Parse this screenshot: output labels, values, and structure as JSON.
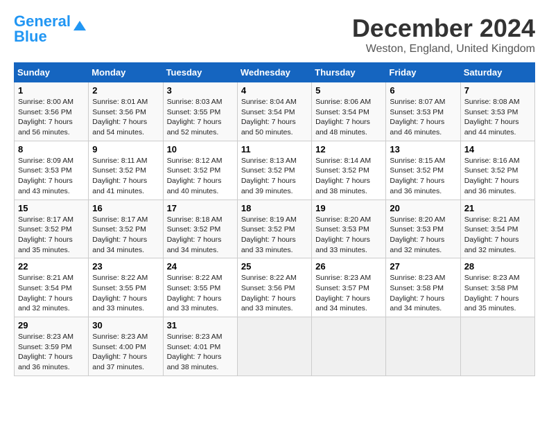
{
  "logo": {
    "text_general": "General",
    "text_blue": "Blue"
  },
  "title": {
    "month_year": "December 2024",
    "location": "Weston, England, United Kingdom"
  },
  "weekdays": [
    "Sunday",
    "Monday",
    "Tuesday",
    "Wednesday",
    "Thursday",
    "Friday",
    "Saturday"
  ],
  "weeks": [
    [
      {
        "day": "1",
        "sunrise": "8:00 AM",
        "sunset": "3:56 PM",
        "daylight": "7 hours and 56 minutes."
      },
      {
        "day": "2",
        "sunrise": "8:01 AM",
        "sunset": "3:56 PM",
        "daylight": "7 hours and 54 minutes."
      },
      {
        "day": "3",
        "sunrise": "8:03 AM",
        "sunset": "3:55 PM",
        "daylight": "7 hours and 52 minutes."
      },
      {
        "day": "4",
        "sunrise": "8:04 AM",
        "sunset": "3:54 PM",
        "daylight": "7 hours and 50 minutes."
      },
      {
        "day": "5",
        "sunrise": "8:06 AM",
        "sunset": "3:54 PM",
        "daylight": "7 hours and 48 minutes."
      },
      {
        "day": "6",
        "sunrise": "8:07 AM",
        "sunset": "3:53 PM",
        "daylight": "7 hours and 46 minutes."
      },
      {
        "day": "7",
        "sunrise": "8:08 AM",
        "sunset": "3:53 PM",
        "daylight": "7 hours and 44 minutes."
      }
    ],
    [
      {
        "day": "8",
        "sunrise": "8:09 AM",
        "sunset": "3:53 PM",
        "daylight": "7 hours and 43 minutes."
      },
      {
        "day": "9",
        "sunrise": "8:11 AM",
        "sunset": "3:52 PM",
        "daylight": "7 hours and 41 minutes."
      },
      {
        "day": "10",
        "sunrise": "8:12 AM",
        "sunset": "3:52 PM",
        "daylight": "7 hours and 40 minutes."
      },
      {
        "day": "11",
        "sunrise": "8:13 AM",
        "sunset": "3:52 PM",
        "daylight": "7 hours and 39 minutes."
      },
      {
        "day": "12",
        "sunrise": "8:14 AM",
        "sunset": "3:52 PM",
        "daylight": "7 hours and 38 minutes."
      },
      {
        "day": "13",
        "sunrise": "8:15 AM",
        "sunset": "3:52 PM",
        "daylight": "7 hours and 36 minutes."
      },
      {
        "day": "14",
        "sunrise": "8:16 AM",
        "sunset": "3:52 PM",
        "daylight": "7 hours and 36 minutes."
      }
    ],
    [
      {
        "day": "15",
        "sunrise": "8:17 AM",
        "sunset": "3:52 PM",
        "daylight": "7 hours and 35 minutes."
      },
      {
        "day": "16",
        "sunrise": "8:17 AM",
        "sunset": "3:52 PM",
        "daylight": "7 hours and 34 minutes."
      },
      {
        "day": "17",
        "sunrise": "8:18 AM",
        "sunset": "3:52 PM",
        "daylight": "7 hours and 34 minutes."
      },
      {
        "day": "18",
        "sunrise": "8:19 AM",
        "sunset": "3:52 PM",
        "daylight": "7 hours and 33 minutes."
      },
      {
        "day": "19",
        "sunrise": "8:20 AM",
        "sunset": "3:53 PM",
        "daylight": "7 hours and 33 minutes."
      },
      {
        "day": "20",
        "sunrise": "8:20 AM",
        "sunset": "3:53 PM",
        "daylight": "7 hours and 32 minutes."
      },
      {
        "day": "21",
        "sunrise": "8:21 AM",
        "sunset": "3:54 PM",
        "daylight": "7 hours and 32 minutes."
      }
    ],
    [
      {
        "day": "22",
        "sunrise": "8:21 AM",
        "sunset": "3:54 PM",
        "daylight": "7 hours and 32 minutes."
      },
      {
        "day": "23",
        "sunrise": "8:22 AM",
        "sunset": "3:55 PM",
        "daylight": "7 hours and 33 minutes."
      },
      {
        "day": "24",
        "sunrise": "8:22 AM",
        "sunset": "3:55 PM",
        "daylight": "7 hours and 33 minutes."
      },
      {
        "day": "25",
        "sunrise": "8:22 AM",
        "sunset": "3:56 PM",
        "daylight": "7 hours and 33 minutes."
      },
      {
        "day": "26",
        "sunrise": "8:23 AM",
        "sunset": "3:57 PM",
        "daylight": "7 hours and 34 minutes."
      },
      {
        "day": "27",
        "sunrise": "8:23 AM",
        "sunset": "3:58 PM",
        "daylight": "7 hours and 34 minutes."
      },
      {
        "day": "28",
        "sunrise": "8:23 AM",
        "sunset": "3:58 PM",
        "daylight": "7 hours and 35 minutes."
      }
    ],
    [
      {
        "day": "29",
        "sunrise": "8:23 AM",
        "sunset": "3:59 PM",
        "daylight": "7 hours and 36 minutes."
      },
      {
        "day": "30",
        "sunrise": "8:23 AM",
        "sunset": "4:00 PM",
        "daylight": "7 hours and 37 minutes."
      },
      {
        "day": "31",
        "sunrise": "8:23 AM",
        "sunset": "4:01 PM",
        "daylight": "7 hours and 38 minutes."
      },
      null,
      null,
      null,
      null
    ]
  ],
  "labels": {
    "sunrise": "Sunrise:",
    "sunset": "Sunset:",
    "daylight": "Daylight:"
  }
}
